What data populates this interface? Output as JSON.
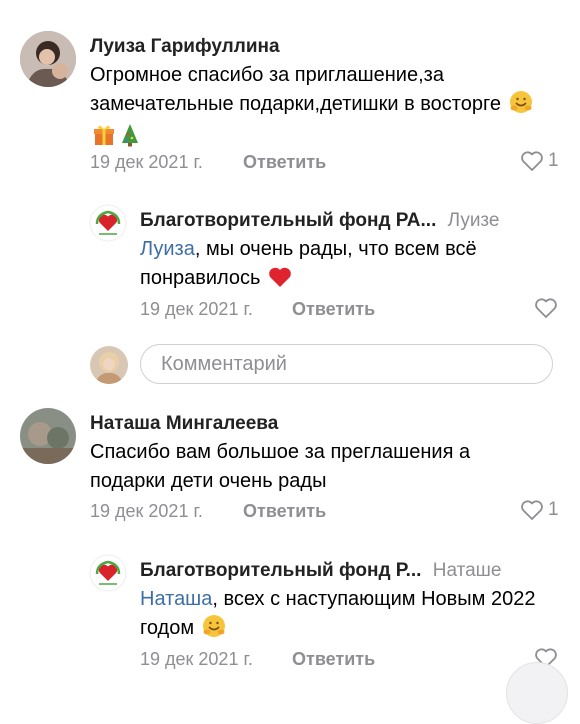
{
  "comments": [
    {
      "author": "Луиза Гарифуллина",
      "text": "Огромное спасибо за приглашение,за замечательные подарки,детишки в восторге",
      "emojis": [
        "hugging-face-emoji",
        "gift-emoji",
        "christmas-tree-emoji"
      ],
      "date": "19 дек 2021 г.",
      "reply_label": "Ответить",
      "likes": "1",
      "reply": {
        "author": "Благотворительный фонд РА...",
        "reply_to": "Луизе",
        "mention": "Луиза",
        "text": ", мы очень рады, что всем всё понравилось",
        "emoji": "red-heart-emoji",
        "date": "19 дек 2021 г.",
        "reply_label": "Ответить"
      }
    },
    {
      "author": "Наташа Мингалеева",
      "text": "Спасибо вам большое за преглашения а подарки дети очень рады",
      "date": "19 дек 2021 г.",
      "reply_label": "Ответить",
      "likes": "1",
      "reply": {
        "author": "Благотворительный фонд Р...",
        "reply_to": "Наташе",
        "mention": "Наташа",
        "text": ", всех с наступающим Новым 2022 годом",
        "emoji": "hugging-face-emoji",
        "date": "19 дек 2021 г.",
        "reply_label": "Ответить"
      }
    }
  ],
  "comment_input": {
    "placeholder": "Комментарий"
  },
  "colors": {
    "mention": "#3d6ea8",
    "meta": "#8e8e93",
    "heart": "#e0242f"
  }
}
